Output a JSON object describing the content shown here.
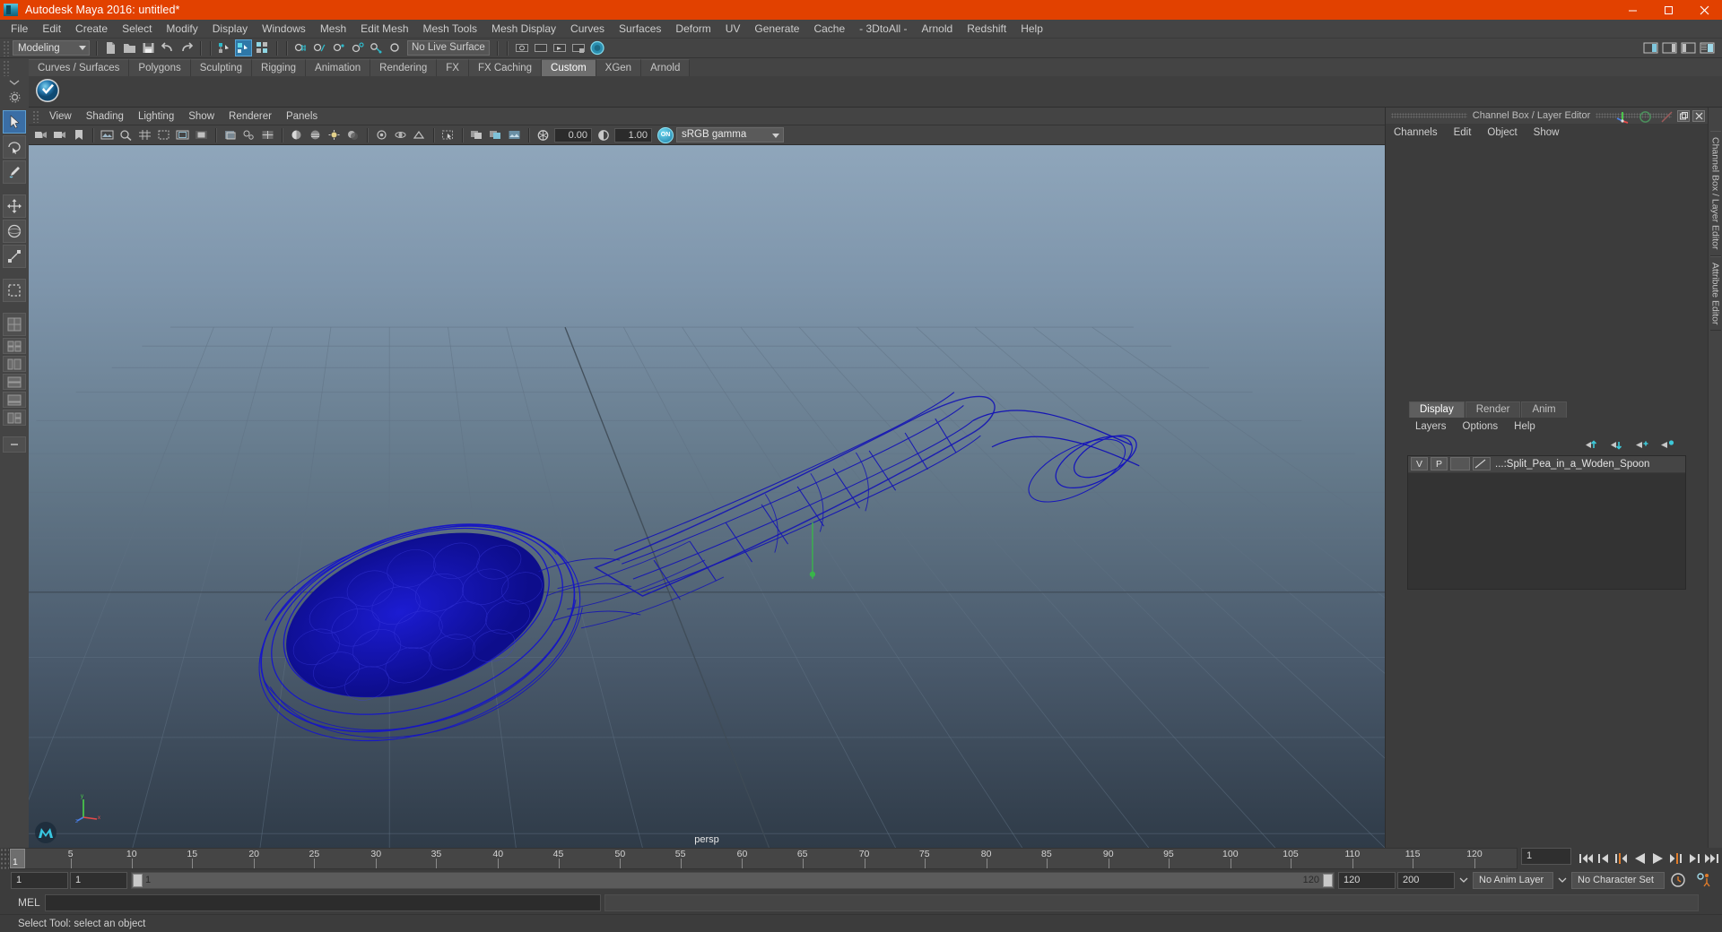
{
  "window": {
    "title": "Autodesk Maya 2016: untitled*",
    "minimize": "minimize",
    "maximize": "maximize",
    "close": "close"
  },
  "menubar": {
    "items": [
      "File",
      "Edit",
      "Create",
      "Select",
      "Modify",
      "Display",
      "Windows",
      "Mesh",
      "Edit Mesh",
      "Mesh Tools",
      "Mesh Display",
      "Curves",
      "Surfaces",
      "Deform",
      "UV",
      "Generate",
      "Cache",
      "- 3DtoAll -",
      "Arnold",
      "Redshift",
      "Help"
    ]
  },
  "statusline": {
    "mode": "Modeling",
    "live_surface": "No Live Surface"
  },
  "shelf": {
    "tabs": [
      "Curves / Surfaces",
      "Polygons",
      "Sculpting",
      "Rigging",
      "Animation",
      "Rendering",
      "FX",
      "FX Caching",
      "Custom",
      "XGen",
      "Arnold"
    ],
    "active_tab": "Custom"
  },
  "viewport_panel": {
    "menus": [
      "View",
      "Shading",
      "Lighting",
      "Show",
      "Renderer",
      "Panels"
    ],
    "exposure": "0.00",
    "gamma": "1.00",
    "color_profile": "sRGB gamma",
    "toggle_state": "ON",
    "camera_label": "persp"
  },
  "right_panel": {
    "header_title": "Channel Box / Layer Editor",
    "channel_menus": [
      "Channels",
      "Edit",
      "Object",
      "Show"
    ],
    "layer_tabs": [
      "Display",
      "Render",
      "Anim"
    ],
    "layer_active_tab": "Display",
    "layer_menus": [
      "Layers",
      "Options",
      "Help"
    ],
    "layers": [
      {
        "visibility": "V",
        "playback": "P",
        "name": "...:Split_Pea_in_a_Woden_Spoon"
      }
    ],
    "vertical_tabs": [
      "Channel Box / Layer Editor",
      "Attribute Editor"
    ]
  },
  "timeline": {
    "tick_labels": [
      "5",
      "10",
      "15",
      "20",
      "25",
      "30",
      "35",
      "40",
      "45",
      "50",
      "55",
      "60",
      "65",
      "70",
      "75",
      "80",
      "85",
      "90",
      "95",
      "100",
      "105",
      "110",
      "115",
      "120"
    ],
    "current_frame_marker": "1",
    "current_frame_field": "1",
    "range_start": "1",
    "range_end": "1",
    "slider_start_label": "1",
    "slider_end_label": "120",
    "anim_end": "120",
    "playback_end": "200",
    "anim_layer": "No Anim Layer",
    "character_set": "No Character Set"
  },
  "command_line": {
    "label": "MEL",
    "input_value": "",
    "output_value": ""
  },
  "status": {
    "message": "Select Tool: select an object"
  },
  "colors": {
    "title_bar": "#e24100",
    "chrome": "#444444",
    "panel": "#3c3c3c",
    "accent_blue": "#2e78a8",
    "mesh_wireframe": "#1414b4",
    "viewport_top": "#8fa6bb",
    "viewport_bottom": "#33404e"
  }
}
